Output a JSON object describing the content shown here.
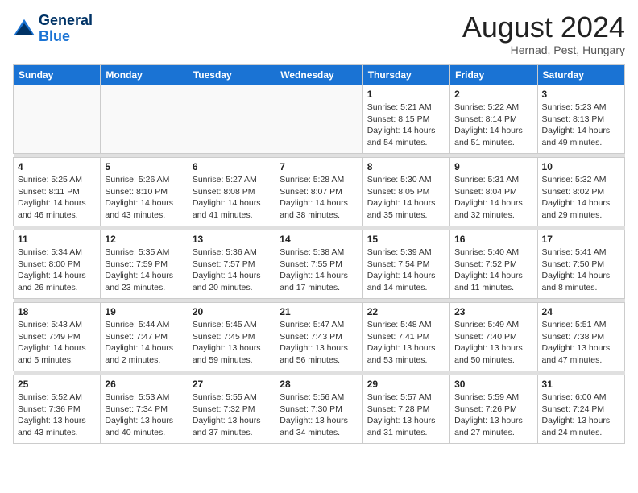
{
  "header": {
    "logo_line1": "General",
    "logo_line2": "Blue",
    "month_title": "August 2024",
    "location": "Hernad, Pest, Hungary"
  },
  "weekdays": [
    "Sunday",
    "Monday",
    "Tuesday",
    "Wednesday",
    "Thursday",
    "Friday",
    "Saturday"
  ],
  "weeks": [
    [
      {
        "day": "",
        "info": ""
      },
      {
        "day": "",
        "info": ""
      },
      {
        "day": "",
        "info": ""
      },
      {
        "day": "",
        "info": ""
      },
      {
        "day": "1",
        "info": "Sunrise: 5:21 AM\nSunset: 8:15 PM\nDaylight: 14 hours\nand 54 minutes."
      },
      {
        "day": "2",
        "info": "Sunrise: 5:22 AM\nSunset: 8:14 PM\nDaylight: 14 hours\nand 51 minutes."
      },
      {
        "day": "3",
        "info": "Sunrise: 5:23 AM\nSunset: 8:13 PM\nDaylight: 14 hours\nand 49 minutes."
      }
    ],
    [
      {
        "day": "4",
        "info": "Sunrise: 5:25 AM\nSunset: 8:11 PM\nDaylight: 14 hours\nand 46 minutes."
      },
      {
        "day": "5",
        "info": "Sunrise: 5:26 AM\nSunset: 8:10 PM\nDaylight: 14 hours\nand 43 minutes."
      },
      {
        "day": "6",
        "info": "Sunrise: 5:27 AM\nSunset: 8:08 PM\nDaylight: 14 hours\nand 41 minutes."
      },
      {
        "day": "7",
        "info": "Sunrise: 5:28 AM\nSunset: 8:07 PM\nDaylight: 14 hours\nand 38 minutes."
      },
      {
        "day": "8",
        "info": "Sunrise: 5:30 AM\nSunset: 8:05 PM\nDaylight: 14 hours\nand 35 minutes."
      },
      {
        "day": "9",
        "info": "Sunrise: 5:31 AM\nSunset: 8:04 PM\nDaylight: 14 hours\nand 32 minutes."
      },
      {
        "day": "10",
        "info": "Sunrise: 5:32 AM\nSunset: 8:02 PM\nDaylight: 14 hours\nand 29 minutes."
      }
    ],
    [
      {
        "day": "11",
        "info": "Sunrise: 5:34 AM\nSunset: 8:00 PM\nDaylight: 14 hours\nand 26 minutes."
      },
      {
        "day": "12",
        "info": "Sunrise: 5:35 AM\nSunset: 7:59 PM\nDaylight: 14 hours\nand 23 minutes."
      },
      {
        "day": "13",
        "info": "Sunrise: 5:36 AM\nSunset: 7:57 PM\nDaylight: 14 hours\nand 20 minutes."
      },
      {
        "day": "14",
        "info": "Sunrise: 5:38 AM\nSunset: 7:55 PM\nDaylight: 14 hours\nand 17 minutes."
      },
      {
        "day": "15",
        "info": "Sunrise: 5:39 AM\nSunset: 7:54 PM\nDaylight: 14 hours\nand 14 minutes."
      },
      {
        "day": "16",
        "info": "Sunrise: 5:40 AM\nSunset: 7:52 PM\nDaylight: 14 hours\nand 11 minutes."
      },
      {
        "day": "17",
        "info": "Sunrise: 5:41 AM\nSunset: 7:50 PM\nDaylight: 14 hours\nand 8 minutes."
      }
    ],
    [
      {
        "day": "18",
        "info": "Sunrise: 5:43 AM\nSunset: 7:49 PM\nDaylight: 14 hours\nand 5 minutes."
      },
      {
        "day": "19",
        "info": "Sunrise: 5:44 AM\nSunset: 7:47 PM\nDaylight: 14 hours\nand 2 minutes."
      },
      {
        "day": "20",
        "info": "Sunrise: 5:45 AM\nSunset: 7:45 PM\nDaylight: 13 hours\nand 59 minutes."
      },
      {
        "day": "21",
        "info": "Sunrise: 5:47 AM\nSunset: 7:43 PM\nDaylight: 13 hours\nand 56 minutes."
      },
      {
        "day": "22",
        "info": "Sunrise: 5:48 AM\nSunset: 7:41 PM\nDaylight: 13 hours\nand 53 minutes."
      },
      {
        "day": "23",
        "info": "Sunrise: 5:49 AM\nSunset: 7:40 PM\nDaylight: 13 hours\nand 50 minutes."
      },
      {
        "day": "24",
        "info": "Sunrise: 5:51 AM\nSunset: 7:38 PM\nDaylight: 13 hours\nand 47 minutes."
      }
    ],
    [
      {
        "day": "25",
        "info": "Sunrise: 5:52 AM\nSunset: 7:36 PM\nDaylight: 13 hours\nand 43 minutes."
      },
      {
        "day": "26",
        "info": "Sunrise: 5:53 AM\nSunset: 7:34 PM\nDaylight: 13 hours\nand 40 minutes."
      },
      {
        "day": "27",
        "info": "Sunrise: 5:55 AM\nSunset: 7:32 PM\nDaylight: 13 hours\nand 37 minutes."
      },
      {
        "day": "28",
        "info": "Sunrise: 5:56 AM\nSunset: 7:30 PM\nDaylight: 13 hours\nand 34 minutes."
      },
      {
        "day": "29",
        "info": "Sunrise: 5:57 AM\nSunset: 7:28 PM\nDaylight: 13 hours\nand 31 minutes."
      },
      {
        "day": "30",
        "info": "Sunrise: 5:59 AM\nSunset: 7:26 PM\nDaylight: 13 hours\nand 27 minutes."
      },
      {
        "day": "31",
        "info": "Sunrise: 6:00 AM\nSunset: 7:24 PM\nDaylight: 13 hours\nand 24 minutes."
      }
    ]
  ]
}
